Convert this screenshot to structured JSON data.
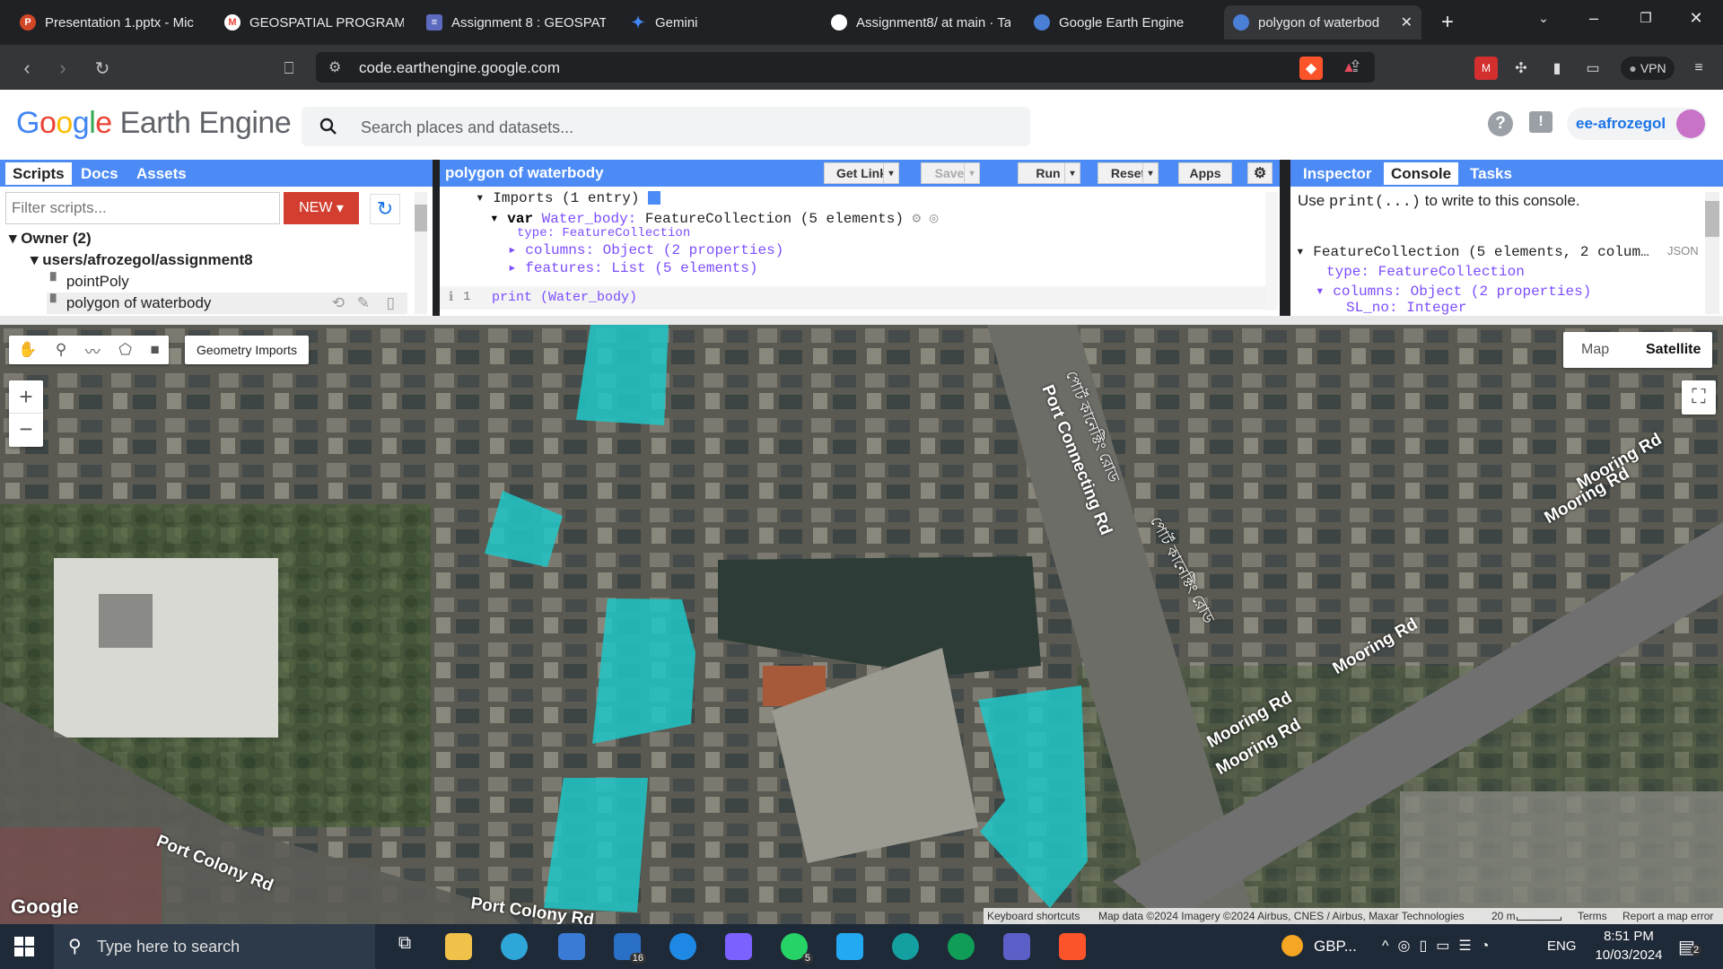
{
  "browser": {
    "tabs": [
      {
        "label": "Presentation 1.pptx - Mic",
        "color": "#d24726",
        "glyph": "P"
      },
      {
        "label": "GEOSPATIAL PROGRAMM",
        "color": "#ea4335",
        "glyph": "M"
      },
      {
        "label": "Assignment 8 : GEOSPATI",
        "color": "#5c6bc0",
        "glyph": "≡"
      },
      {
        "label": "Gemini",
        "color": "#4285f4",
        "glyph": "✦"
      },
      {
        "label": "Assignment8/ at main · Ta",
        "color": "#333",
        "glyph": "●"
      },
      {
        "label": "Google Earth Engine",
        "color": "#4a7fd6",
        "glyph": "●"
      },
      {
        "label": "polygon of waterbod",
        "color": "#4a7fd6",
        "glyph": "●"
      }
    ],
    "url": "code.earthengine.google.com",
    "vpn_label": "VPN"
  },
  "gee": {
    "logo_google": "Google",
    "logo_rest": "Earth Engine",
    "search_placeholder": "Search places and datasets...",
    "user": "ee-afrozegol",
    "left_tabs": [
      "Scripts",
      "Docs",
      "Assets"
    ],
    "filter_placeholder": "Filter scripts...",
    "new_label": "NEW",
    "tree": {
      "owner": "Owner (2)",
      "repo": "users/afrozegol/assignment8",
      "files": [
        "pointPoly",
        "polygon of waterbody"
      ]
    },
    "editor": {
      "title": "polygon of waterbody",
      "buttons": [
        "Get Link",
        "Save",
        "Run",
        "Reset",
        "Apps"
      ],
      "imports_label": "Imports (1 entry)",
      "var_line_kw": "var",
      "var_line_name": "Water_body:",
      "var_line_rest": "FeatureCollection (5 elements)",
      "type_line": "type: FeatureCollection",
      "columns_line": "columns: Object (2 properties)",
      "features_line": "features: List (5 elements)",
      "code_line_no": "1",
      "code": "print (Water_body)"
    },
    "right_tabs": [
      "Inspector",
      "Console",
      "Tasks"
    ],
    "console": {
      "hint_prefix": "Use ",
      "hint_code": "print(...)",
      "hint_suffix": " to write to this console.",
      "fc_line": "FeatureCollection (5 elements, 2 colum…",
      "json_label": "JSON",
      "type_line": "type: FeatureCollection",
      "columns_line": "columns: Object (2 properties)",
      "sl_line": "SL_no: Integer"
    }
  },
  "map": {
    "geometry_imports": "Geometry Imports",
    "map_types": [
      "Map",
      "Satellite"
    ],
    "road_labels": [
      "Port Connecting Rd",
      "Mooring Rd",
      "Mooring Rd",
      "Mooring Rd",
      "Mooring Rd",
      "Mooring Rd",
      "Port Colony Rd",
      "Port Colony Rd"
    ],
    "bengali_labels": [
      "পোর্ট কানেক্টিং রোড",
      "পোর্ট কানেক্টিং রোড"
    ],
    "google_watermark": "Google",
    "attribution": {
      "shortcuts": "Keyboard shortcuts",
      "data": "Map data ©2024 Imagery ©2024 Airbus, CNES / Airbus, Maxar Technologies",
      "scale": "20 m",
      "terms": "Terms",
      "report": "Report a map error"
    },
    "polygon_color": "#1fc7c7"
  },
  "taskbar": {
    "search_placeholder": "Type here to search",
    "weather": "GBP...",
    "lang": "ENG",
    "time": "8:51 PM",
    "date": "10/03/2024",
    "mail_badge": "16",
    "whatsapp_badge": "5",
    "notif_badge": "2"
  }
}
